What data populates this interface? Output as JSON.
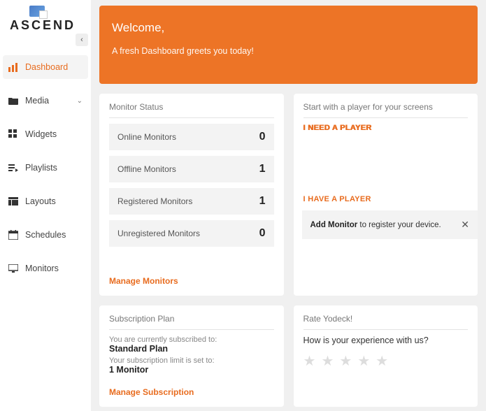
{
  "brand": {
    "name": "ASCEND"
  },
  "sidebar": {
    "items": [
      {
        "label": "Dashboard",
        "icon": "bars-icon",
        "active": true
      },
      {
        "label": "Media",
        "icon": "folder-icon",
        "expandable": true
      },
      {
        "label": "Widgets",
        "icon": "grid-icon"
      },
      {
        "label": "Playlists",
        "icon": "playlist-icon"
      },
      {
        "label": "Layouts",
        "icon": "layout-icon"
      },
      {
        "label": "Schedules",
        "icon": "calendar-icon"
      },
      {
        "label": "Monitors",
        "icon": "monitor-icon"
      }
    ]
  },
  "hero": {
    "title": "Welcome,",
    "subtitle": "A fresh Dashboard greets you today!"
  },
  "monitor_status": {
    "title": "Monitor Status",
    "rows": [
      {
        "label": "Online Monitors",
        "value": "0"
      },
      {
        "label": "Offline Monitors",
        "value": "1"
      },
      {
        "label": "Registered Monitors",
        "value": "1"
      },
      {
        "label": "Unregistered Monitors",
        "value": "0"
      }
    ],
    "action": "Manage Monitors"
  },
  "start_player": {
    "title": "Start with a player for your screens",
    "need_label": "I NEED A PLAYER",
    "have_label": "I HAVE A PLAYER",
    "add_prefix": "Add Monitor",
    "add_suffix": " to register your device."
  },
  "subscription": {
    "title": "Subscription Plan",
    "line1": "You are currently subscribed to:",
    "plan": "Standard Plan",
    "line2": "Your subscription limit is set to:",
    "limit": "1 Monitor",
    "action": "Manage Subscription"
  },
  "rate": {
    "title": "Rate Yodeck!",
    "question": "How is your experience with us?"
  }
}
